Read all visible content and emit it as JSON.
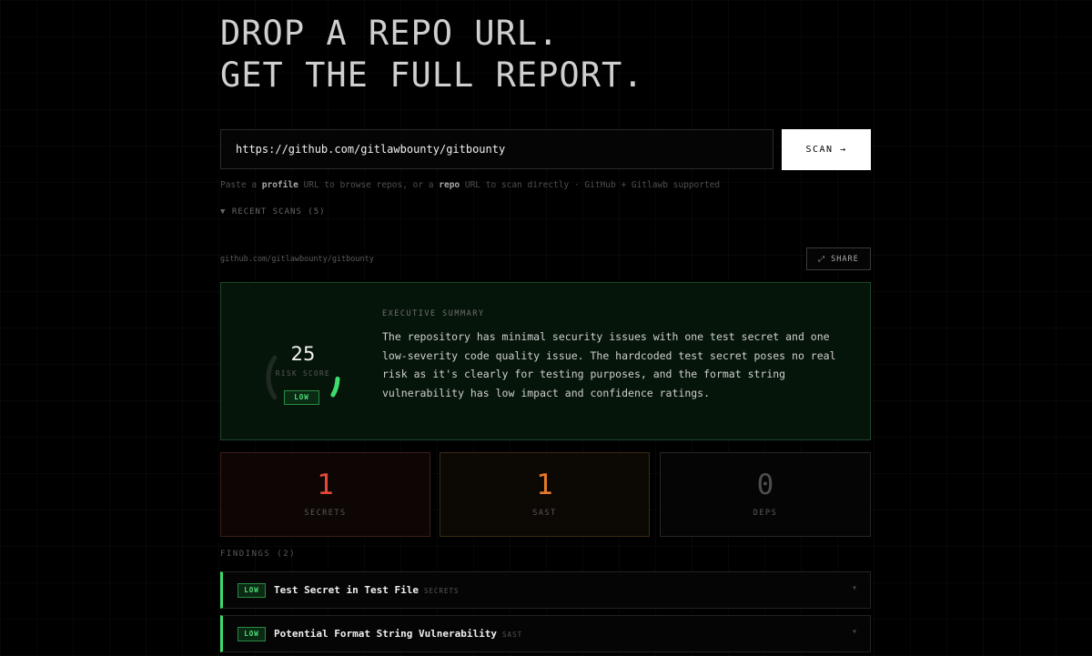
{
  "hero": {
    "line1": "DROP A REPO URL.",
    "line2": "GET THE FULL REPORT."
  },
  "search": {
    "value": "https://github.com/gitlawbounty/gitbounty",
    "scan_label": "SCAN →"
  },
  "hint": {
    "prefix": "Paste a ",
    "profile": "profile",
    "middle": " URL to browse repos, or a ",
    "repo": "repo",
    "suffix": " URL to scan directly · GitHub + Gitlawb supported"
  },
  "recent_scans": "▼ RECENT SCANS (5)",
  "report": {
    "repo_path": "github.com/gitlawbounty/gitbounty",
    "share_label": "⤢ SHARE"
  },
  "summary": {
    "score": "25",
    "score_value": 25,
    "score_label": "RISK SCORE",
    "level": "LOW",
    "exec_label": "EXECUTIVE SUMMARY",
    "exec_text": "The repository has minimal security issues with one test secret and one low-severity code quality issue. The hardcoded test secret poses no real risk as it's clearly for testing purposes, and the format string vulnerability has low impact and confidence ratings.",
    "accent": "#3ddc6c"
  },
  "stats": {
    "secrets": {
      "value": "1",
      "label": "SECRETS",
      "color": "#e5483a"
    },
    "sast": {
      "value": "1",
      "label": "SAST",
      "color": "#e07a2c"
    },
    "deps": {
      "value": "0",
      "label": "DEPS",
      "color": "#4d4d4d"
    }
  },
  "findings": {
    "title": "FINDINGS (2)",
    "items": [
      {
        "severity": "LOW",
        "title": "Test Secret in Test File",
        "category": "SECRETS"
      },
      {
        "severity": "LOW",
        "title": "Potential Format String Vulnerability",
        "category": "SAST"
      }
    ]
  }
}
